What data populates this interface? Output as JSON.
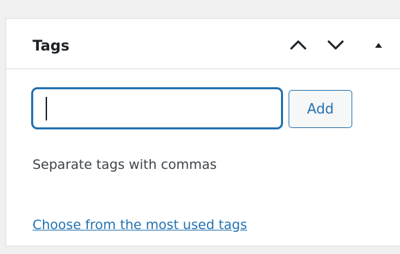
{
  "panel": {
    "title": "Tags",
    "controls": {
      "move_up_icon": "chevron-up-icon",
      "move_down_icon": "chevron-down-icon",
      "toggle_icon": "triangle-up-icon"
    }
  },
  "tag_form": {
    "input_value": "",
    "add_label": "Add",
    "help_text": "Separate tags with commas",
    "most_used_link": "Choose from the most used tags"
  },
  "colors": {
    "accent": "#2271b1",
    "text": "#1d2327",
    "border": "#dcdcde",
    "background": "#f0f0f1"
  }
}
